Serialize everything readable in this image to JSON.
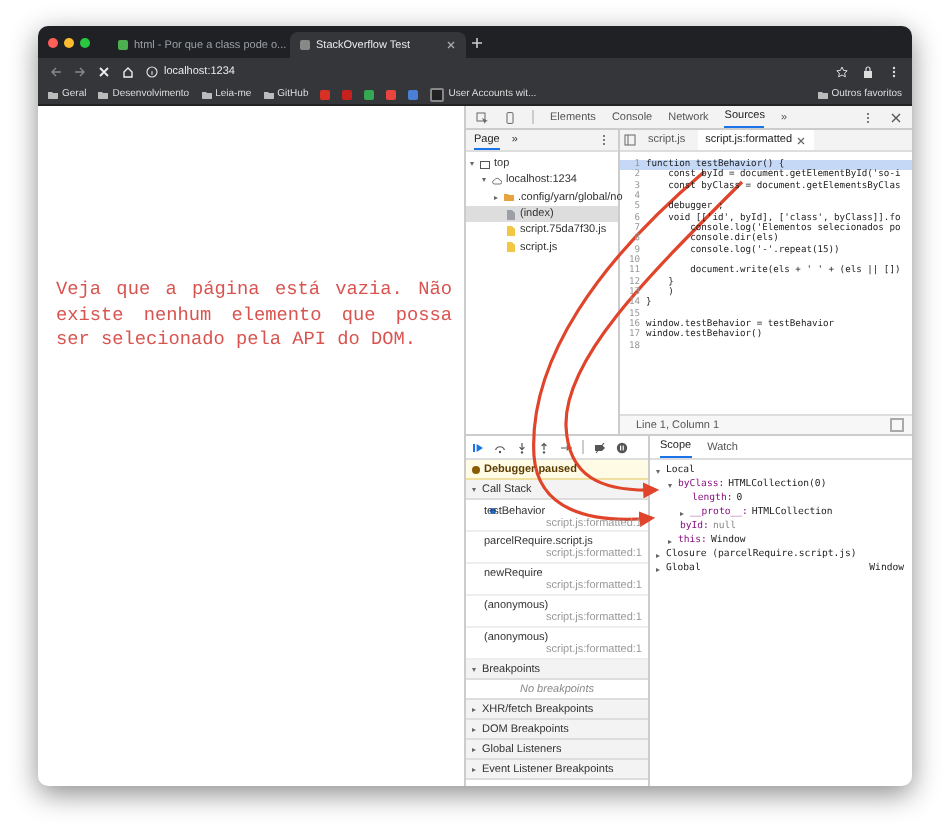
{
  "browser": {
    "tabs": [
      {
        "title": "html - Por que a class pode o...",
        "selected": false
      },
      {
        "title": "StackOverflow Test",
        "selected": true
      }
    ],
    "address": "localhost:1234",
    "bookmarks": [
      {
        "kind": "folder",
        "label": "Geral"
      },
      {
        "kind": "folder",
        "label": "Desenvolvimento"
      },
      {
        "kind": "folder",
        "label": "Leia-me"
      },
      {
        "kind": "folder",
        "label": "GitHub"
      },
      {
        "kind": "favicon",
        "color": "#d93025"
      },
      {
        "kind": "favicon",
        "color": "#c5221f"
      },
      {
        "kind": "favicon",
        "color": "#34a853"
      },
      {
        "kind": "favicon",
        "color": "#e8453c"
      },
      {
        "kind": "favicon",
        "color": "#4a7fd6"
      },
      {
        "kind": "site",
        "label": "User Accounts wit..."
      }
    ],
    "other_bookmarks": "Outros favoritos"
  },
  "page": {
    "message": "Veja que a página está vazia. Não existe nenhum elemento que possa ser selecionado pela API do DOM."
  },
  "devtools": {
    "panel_tabs": [
      {
        "label": "Elements",
        "selected": false
      },
      {
        "label": "Console",
        "selected": false
      },
      {
        "label": "Network",
        "selected": false
      },
      {
        "label": "Sources",
        "selected": true
      }
    ],
    "more_tabs": "»",
    "navigator": {
      "tabs": [
        {
          "label": "Page",
          "selected": true
        }
      ],
      "more": "»",
      "tree": [
        {
          "kind": "frame",
          "label": "top",
          "expanded": true,
          "selected": false,
          "children": [
            {
              "kind": "cloud",
              "label": "localhost:1234",
              "expanded": true,
              "selected": false,
              "children": [
                {
                  "kind": "folder",
                  "label": ".config/yarn/global/no",
                  "expanded": false,
                  "selected": false
                },
                {
                  "kind": "document",
                  "label": "(index)",
                  "selected": true
                },
                {
                  "kind": "script",
                  "label": "script.75da7f30.js",
                  "selected": false
                },
                {
                  "kind": "script",
                  "label": "script.js",
                  "selected": false
                }
              ]
            }
          ]
        }
      ]
    },
    "editor": {
      "tabs": [
        {
          "label": "script.js",
          "selected": false,
          "closable": false
        },
        {
          "label": "script.js:formatted",
          "selected": true,
          "closable": true
        }
      ],
      "lines": [
        {
          "number": "1",
          "code": "function testBehavior() {",
          "highlighted": true
        },
        {
          "number": "2",
          "code": "    const byId = document.getElementById('so-i",
          "highlighted": false
        },
        {
          "number": "3",
          "code": "    const byClass = document.getElementsByClas",
          "highlighted": false
        },
        {
          "number": "4",
          "highlighted": false
        },
        {
          "number": "5",
          "code": "    debugger ;",
          "highlighted": false
        },
        {
          "number": "6",
          "code": "    void [['id', byId], ['class', byClass]].fo",
          "highlighted": false
        },
        {
          "number": "7",
          "code": "        console.log('Elementos selecionados po",
          "highlighted": false
        },
        {
          "number": "8",
          "code": "        console.dir(els)",
          "highlighted": false
        },
        {
          "number": "9",
          "code": "        console.log('-'.repeat(15))",
          "highlighted": false
        },
        {
          "number": "10",
          "highlighted": false
        },
        {
          "number": "11",
          "code": "        document.write(els + ' ' + (els || [])",
          "highlighted": false
        },
        {
          "number": "12",
          "code": "    }",
          "highlighted": false
        },
        {
          "number": "13",
          "code": "    )",
          "highlighted": false
        },
        {
          "number": "14",
          "code": "}",
          "highlighted": false
        },
        {
          "number": "15",
          "highlighted": false
        },
        {
          "number": "16",
          "code": "window.testBehavior = testBehavior",
          "highlighted": false
        },
        {
          "number": "17",
          "code": "window.testBehavior()",
          "highlighted": false
        },
        {
          "number": "18",
          "highlighted": false
        }
      ],
      "status": "Line 1, Column 1"
    },
    "debugger": {
      "paused_message": "Debugger paused",
      "call_stack": {
        "title": "Call Stack",
        "expanded": true,
        "frames": [
          {
            "function": "testBehavior",
            "location": "script.js:formatted:1",
            "selected": true
          },
          {
            "function": "parcelRequire.script.js",
            "location": "script.js:formatted:1",
            "selected": false
          },
          {
            "function": "newRequire",
            "location": "script.js:formatted:1",
            "selected": false
          },
          {
            "function": "(anonymous)",
            "location": "script.js:formatted:1",
            "selected": false
          },
          {
            "function": "(anonymous)",
            "location": "script.js:formatted:1",
            "selected": false
          }
        ]
      },
      "breakpoints": {
        "title": "Breakpoints",
        "expanded": true,
        "message": "No breakpoints"
      },
      "sections": [
        {
          "title": "XHR/fetch Breakpoints",
          "expanded": false
        },
        {
          "title": "DOM Breakpoints",
          "expanded": false
        },
        {
          "title": "Global Listeners",
          "expanded": false
        },
        {
          "title": "Event Listener Breakpoints",
          "expanded": false
        }
      ]
    },
    "scope": {
      "tabs": [
        {
          "label": "Scope",
          "selected": true
        },
        {
          "label": "Watch",
          "selected": false
        }
      ],
      "tree": [
        {
          "name": "Local",
          "expanded": true,
          "children": [
            {
              "name": "byClass:",
              "value": "HTMLCollection(0)",
              "expanded": true,
              "children": [
                {
                  "name": "length:",
                  "value": "0"
                },
                {
                  "name": "__proto__:",
                  "value": "HTMLCollection",
                  "expanded": false
                }
              ]
            },
            {
              "name": "byId:",
              "value": "null"
            },
            {
              "name": "this:",
              "value": "Window",
              "expanded": false
            }
          ]
        },
        {
          "name": "Closure (parcelRequire.script.js)",
          "expanded": false
        },
        {
          "name": "Global",
          "value": "Window",
          "expanded": false
        }
      ]
    }
  }
}
